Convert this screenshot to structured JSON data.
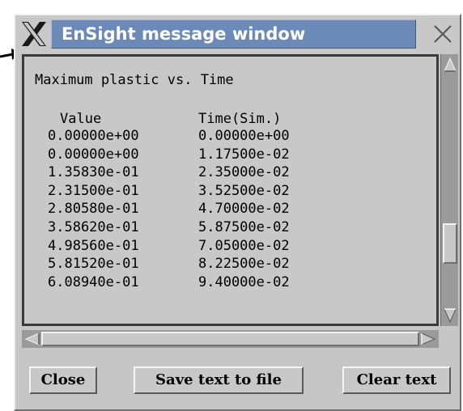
{
  "window": {
    "title": "EnSight message window",
    "logo_icon": "x-window-logo-icon",
    "close_icon": "close-icon"
  },
  "text": {
    "heading": "Maximum plastic vs. Time",
    "col_value": "Value",
    "col_time": "Time(Sim.)",
    "rows": [
      {
        "value": "0.00000e+00",
        "time": "0.00000e+00"
      },
      {
        "value": "0.00000e+00",
        "time": "1.17500e-02"
      },
      {
        "value": "1.35830e-01",
        "time": "2.35000e-02"
      },
      {
        "value": "2.31500e-01",
        "time": "3.52500e-02"
      },
      {
        "value": "2.80580e-01",
        "time": "4.70000e-02"
      },
      {
        "value": "3.58620e-01",
        "time": "5.87500e-02"
      },
      {
        "value": "4.98560e-01",
        "time": "7.05000e-02"
      },
      {
        "value": "5.81520e-01",
        "time": "8.22500e-02"
      },
      {
        "value": "6.08940e-01",
        "time": "9.40000e-02"
      }
    ]
  },
  "scrollbars": {
    "vertical_position": 0.78,
    "horizontal_position": 0.0
  },
  "buttons": {
    "close": "Close",
    "save": "Save text to file",
    "clear": "Clear text"
  },
  "colors": {
    "title_bar": "#6b8ab8",
    "panel": "#c8c8c8",
    "scroll_trough": "#9a9a9a"
  }
}
